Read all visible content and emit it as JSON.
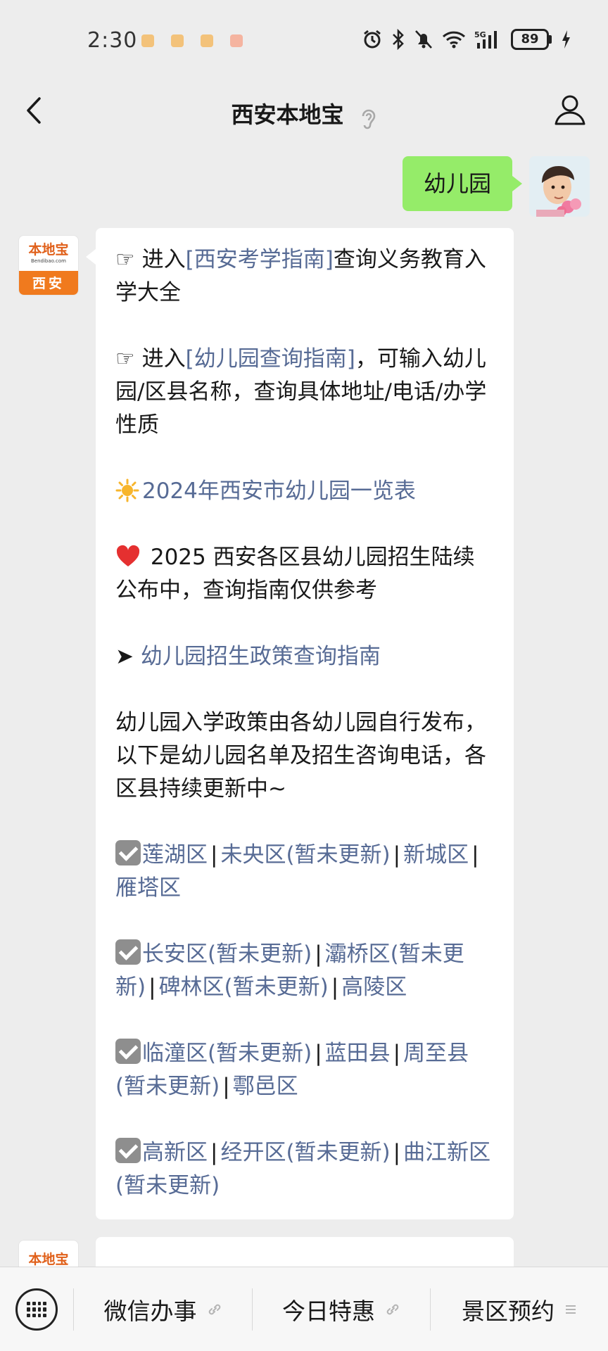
{
  "status_bar": {
    "time": "2:30",
    "battery_level": "89",
    "network": "5G"
  },
  "header": {
    "title": "西安本地宝",
    "icons": [
      "back-arrow-icon",
      "ear-icon",
      "person-icon"
    ]
  },
  "chat": {
    "sent_message": "幼儿园",
    "bot": {
      "logo_name": "本地宝",
      "logo_url": "Bendibao.com",
      "logo_city": "西安"
    },
    "messages": {
      "p1_prefix": "☞ 进入",
      "p1_link": "[西安考学指南]",
      "p1_suffix": "查询义务教育入学大全",
      "p2_prefix": "☞ 进入",
      "p2_link": "[幼儿园查询指南]",
      "p2_suffix": "，可输入幼儿园/区县名称，查询具体地址/电话/办学性质",
      "p3_link": "2024年西安市幼儿园一览表",
      "p4_text": " 2025 西安各区县幼儿园招生陆续公布中，查询指南仅供参考",
      "p5_prefix": "➤ ",
      "p5_link": "幼儿园招生政策查询指南",
      "p6_text": "幼儿园入学政策由各幼儿园自行发布，以下是幼儿园名单及招生咨询电话，各区县持续更新中~",
      "separator": "|",
      "group1": [
        "莲湖区",
        "未央区(暂未更新)",
        "新城区",
        "雁塔区"
      ],
      "group2": [
        "长安区(暂未更新)",
        "灞桥区(暂未更新)",
        "碑林区(暂未更新)",
        "高陵区"
      ],
      "group3": [
        "临潼区(暂未更新)",
        "蓝田县",
        "周至县(暂未更新)",
        "鄠邑区"
      ],
      "group4": [
        "高新区",
        "经开区(暂未更新)",
        "曲江新区(暂未更新)"
      ]
    }
  },
  "bottom_menu": {
    "items": [
      "微信办事",
      "今日特惠",
      "景区预约"
    ],
    "icons": [
      "keyboard-icon",
      "link-icon",
      "link-icon",
      "menu-icon"
    ]
  },
  "colors": {
    "background": "#ededed",
    "sent_bubble": "#95ec69",
    "link": "#576b95",
    "logo_orange": "#f07a1e"
  }
}
